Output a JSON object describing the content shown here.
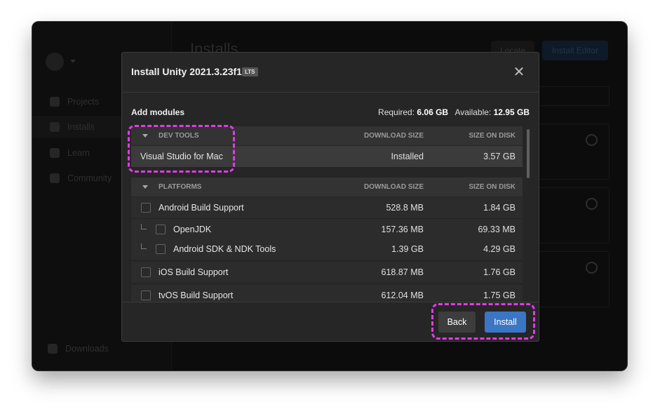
{
  "sidebar": {
    "items": [
      {
        "label": "Projects",
        "icon": "cube-icon"
      },
      {
        "label": "Installs",
        "icon": "lock-icon"
      },
      {
        "label": "Learn",
        "icon": "graduation-cap-icon"
      },
      {
        "label": "Community",
        "icon": "people-icon"
      }
    ],
    "downloads_label": "Downloads"
  },
  "background": {
    "page_title": "Installs",
    "locate_label": "Locate",
    "install_editor_label": "Install Editor"
  },
  "modal": {
    "title": "Install Unity 2021.3.23f1",
    "badge": "LTS",
    "close_icon": "close-icon",
    "add_modules_label": "Add modules",
    "required_label": "Required:",
    "required_value": "6.06 GB",
    "available_label": "Available:",
    "available_value": "12.95 GB",
    "columns": {
      "download_size": "DOWNLOAD SIZE",
      "size_on_disk": "SIZE ON DISK"
    },
    "dev_tools": {
      "header": "DEV TOOLS",
      "rows": [
        {
          "name": "Visual Studio for Mac",
          "download": "Installed",
          "disk": "3.57 GB"
        }
      ]
    },
    "platforms": {
      "header": "PLATFORMS",
      "rows": [
        {
          "name": "Android Build Support",
          "download": "528.8 MB",
          "disk": "1.84 GB"
        },
        {
          "name": "OpenJDK",
          "download": "157.36 MB",
          "disk": "69.33 MB"
        },
        {
          "name": "Android SDK & NDK Tools",
          "download": "1.39 GB",
          "disk": "4.29 GB"
        },
        {
          "name": "iOS Build Support",
          "download": "618.87 MB",
          "disk": "1.76 GB"
        },
        {
          "name": "tvOS Build Support",
          "download": "612.04 MB",
          "disk": "1.75 GB"
        }
      ]
    },
    "back_label": "Back",
    "install_label": "Install"
  },
  "colors": {
    "accent": "#3a76c4",
    "annotation": "#e33be8"
  }
}
